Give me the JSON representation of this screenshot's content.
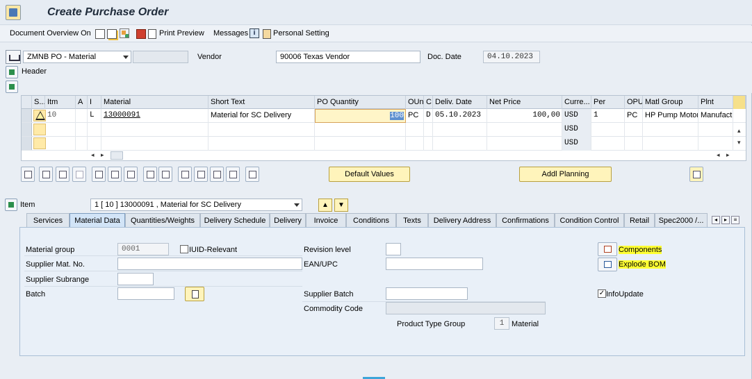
{
  "title": "Create Purchase Order",
  "toolbar": {
    "document_overview": "Document Overview On",
    "print_preview": "Print Preview",
    "messages": "Messages",
    "personal_setting": "Personal Setting"
  },
  "header": {
    "po_type": "ZMNB PO - Material",
    "vendor_label": "Vendor",
    "vendor_value": "90006  Texas Vendor",
    "doc_date_label": "Doc. Date",
    "doc_date_value": "04.10.2023",
    "header_label": "Header"
  },
  "table": {
    "columns": [
      "S...",
      "Itm",
      "A",
      "I",
      "Material",
      "Short Text",
      "PO Quantity",
      "OUn",
      "C",
      "Deliv. Date",
      "Net Price",
      "Curre...",
      "Per",
      "OPU",
      "Matl Group",
      "Plnt"
    ],
    "rows": [
      {
        "item": "10",
        "a": "",
        "i": "L",
        "material": "13000091",
        "short_text": "Material for SC Delivery",
        "qty": "100",
        "oun": "PC",
        "c": "D",
        "deliv_date": "05.10.2023",
        "net_price": "100,00",
        "currency": "USD",
        "per": "1",
        "opu": "PC",
        "matl_group": "HP Pump Motors",
        "plant": "Manufactur"
      },
      {
        "item": "",
        "a": "",
        "i": "",
        "material": "",
        "short_text": "",
        "qty": "",
        "oun": "",
        "c": "",
        "deliv_date": "",
        "net_price": "",
        "currency": "USD",
        "per": "",
        "opu": "",
        "matl_group": "",
        "plant": ""
      },
      {
        "item": "",
        "a": "",
        "i": "",
        "material": "",
        "short_text": "",
        "qty": "",
        "oun": "",
        "c": "",
        "deliv_date": "",
        "net_price": "",
        "currency": "USD",
        "per": "",
        "opu": "",
        "matl_group": "",
        "plant": ""
      }
    ]
  },
  "buttons": {
    "default_values": "Default Values",
    "addl_planning": "Addl Planning"
  },
  "item": {
    "label": "Item",
    "selected": "1 [ 10 ] 13000091 , Material for SC Delivery"
  },
  "tabs": [
    "Services",
    "Material Data",
    "Quantities/Weights",
    "Delivery Schedule",
    "Delivery",
    "Invoice",
    "Conditions",
    "Texts",
    "Delivery Address",
    "Confirmations",
    "Condition Control",
    "Retail",
    "Spec2000 /..."
  ],
  "material_data": {
    "material_group_label": "Material group",
    "material_group_value": "0001",
    "iuid_label": "IUID-Relevant",
    "revision_level_label": "Revision level",
    "supplier_mat_no_label": "Supplier Mat. No.",
    "ean_upc_label": "EAN/UPC",
    "supplier_subrange_label": "Supplier Subrange",
    "batch_label": "Batch",
    "supplier_batch_label": "Supplier Batch",
    "commodity_code_label": "Commodity Code",
    "product_type_group_label": "Product Type Group",
    "product_type_group_value": "1",
    "product_type_group_text": "Material",
    "components_label": "Components",
    "explode_bom_label": "Explode BOM",
    "info_update_label": "InfoUpdate"
  }
}
